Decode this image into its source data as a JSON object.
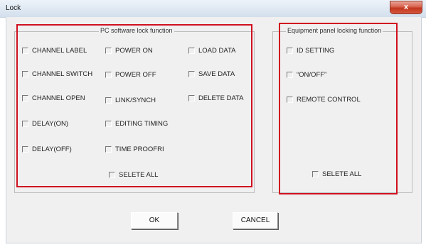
{
  "window": {
    "title": "Lock",
    "close_glyph": "x",
    "close_icon": "close-icon"
  },
  "pc_group": {
    "title": "PC software lock function",
    "col1": [
      "CHANNEL LABEL",
      "CHANNEL SWITCH",
      "CHANNEL OPEN",
      "DELAY(ON)",
      "DELAY(OFF)"
    ],
    "col2": [
      "POWER ON",
      "POWER OFF",
      "LINK/SYNCH",
      "EDITING TIMING",
      "TIME PROOFRI"
    ],
    "col3": [
      "LOAD DATA",
      "SAVE DATA",
      "DELETE DATA"
    ],
    "select_all": "SELETE ALL"
  },
  "panel_group": {
    "title": "Equipment panel locking function",
    "items": [
      "ID SETTING",
      "“ON/OFF”",
      "REMOTE CONTROL"
    ],
    "select_all": "SELETE ALL"
  },
  "buttons": {
    "ok": "OK",
    "cancel": "CANCEL"
  },
  "colors": {
    "highlight": "#d0101f",
    "dialog_bg": "#f0f0f0",
    "close_button": "#c2361f"
  }
}
